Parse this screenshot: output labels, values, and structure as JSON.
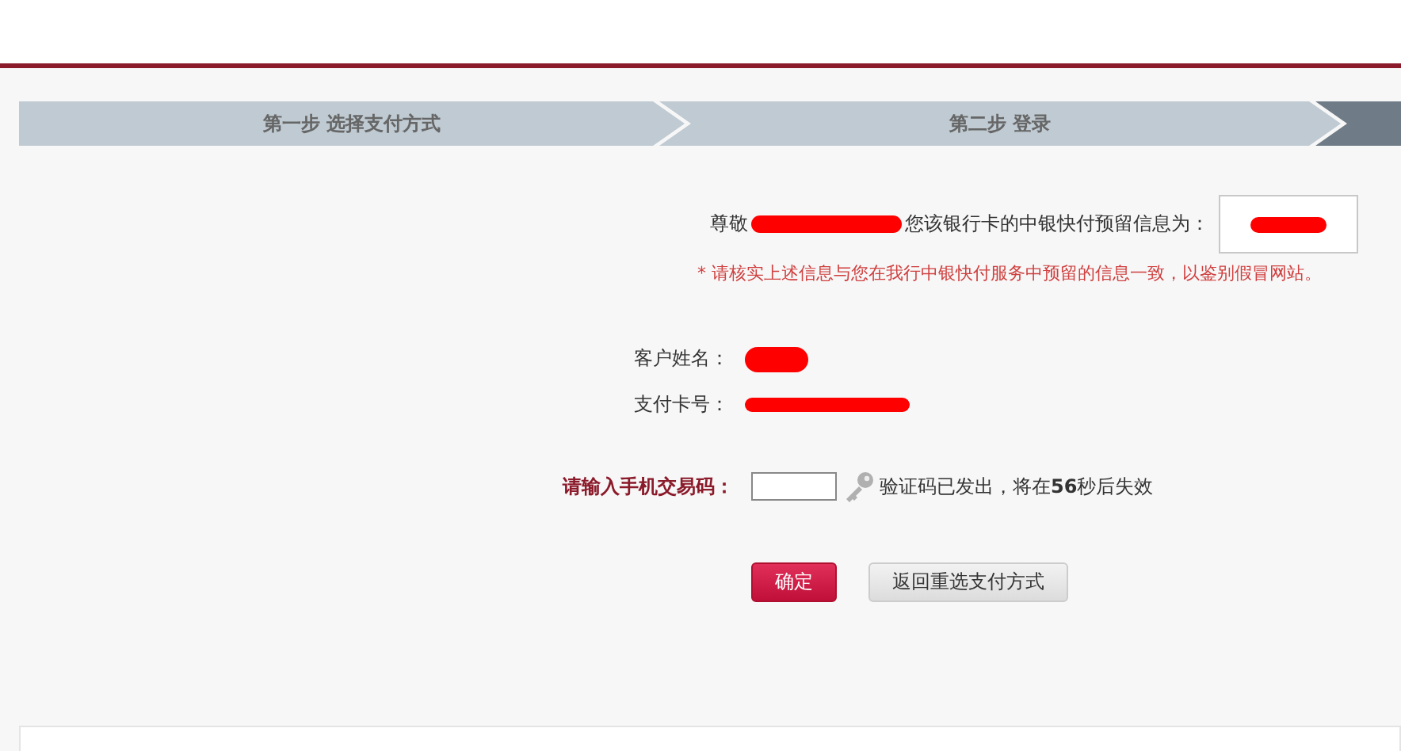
{
  "steps": [
    {
      "label": "第一步  选择支付方式"
    },
    {
      "label": "第二步  登录"
    }
  ],
  "greeting": {
    "prefix": "尊敬",
    "message": "您该银行卡的中银快付预留信息为："
  },
  "note": "* 请核实上述信息与您在我行中银快付服务中预留的信息一致，以鉴别假冒网站。",
  "fields": [
    {
      "label": "客户姓名："
    },
    {
      "label": "支付卡号："
    }
  ],
  "code": {
    "label": "请输入手机交易码：",
    "status": "验证码已发出，将在**56**秒后失效"
  },
  "buttons": [
    {
      "label": "确定",
      "kind": "primary"
    },
    {
      "label": "返回重选支付方式",
      "kind": "secondary"
    }
  ]
}
